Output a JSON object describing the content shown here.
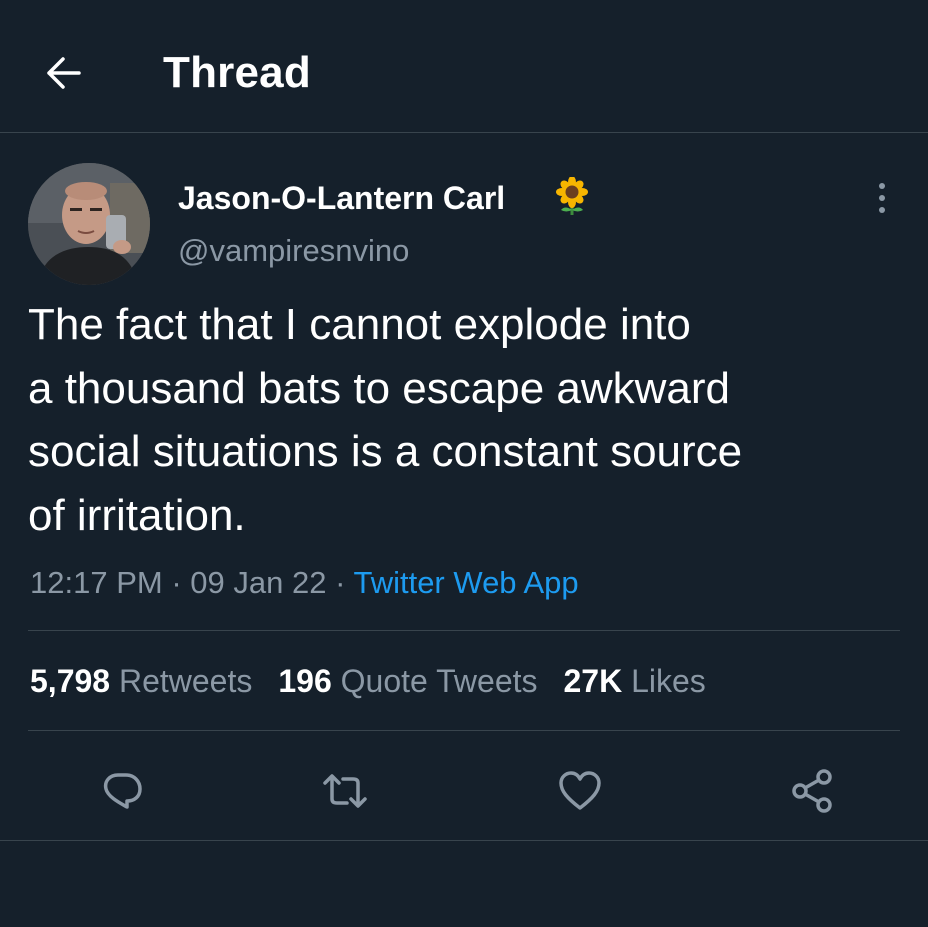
{
  "header": {
    "title": "Thread",
    "back_icon": "arrow-left-icon"
  },
  "tweet": {
    "author": {
      "display_name": "Jason-O-Lantern Carl",
      "badge_icon": "sunflower-emoji-icon",
      "handle": "@vampiresnvino"
    },
    "text_lines": [
      "The fact that I cannot explode into",
      "a thousand bats to escape awkward",
      "social situations is a constant source",
      "of irritation."
    ],
    "time": "12:17 PM",
    "separator": "·",
    "date": "09 Jan 22",
    "source": "Twitter Web App",
    "stats": {
      "retweets_count": "5,798",
      "retweets_label": "Retweets",
      "quotes_count": "196",
      "quotes_label": "Quote Tweets",
      "likes_count": "27K",
      "likes_label": "Likes"
    },
    "actions": [
      "reply-icon",
      "retweet-icon",
      "like-icon",
      "share-icon"
    ]
  },
  "colors": {
    "background": "#15202b",
    "text": "#ffffff",
    "muted": "#8b98a5",
    "link": "#1d9bf0",
    "divider": "#38444d"
  }
}
